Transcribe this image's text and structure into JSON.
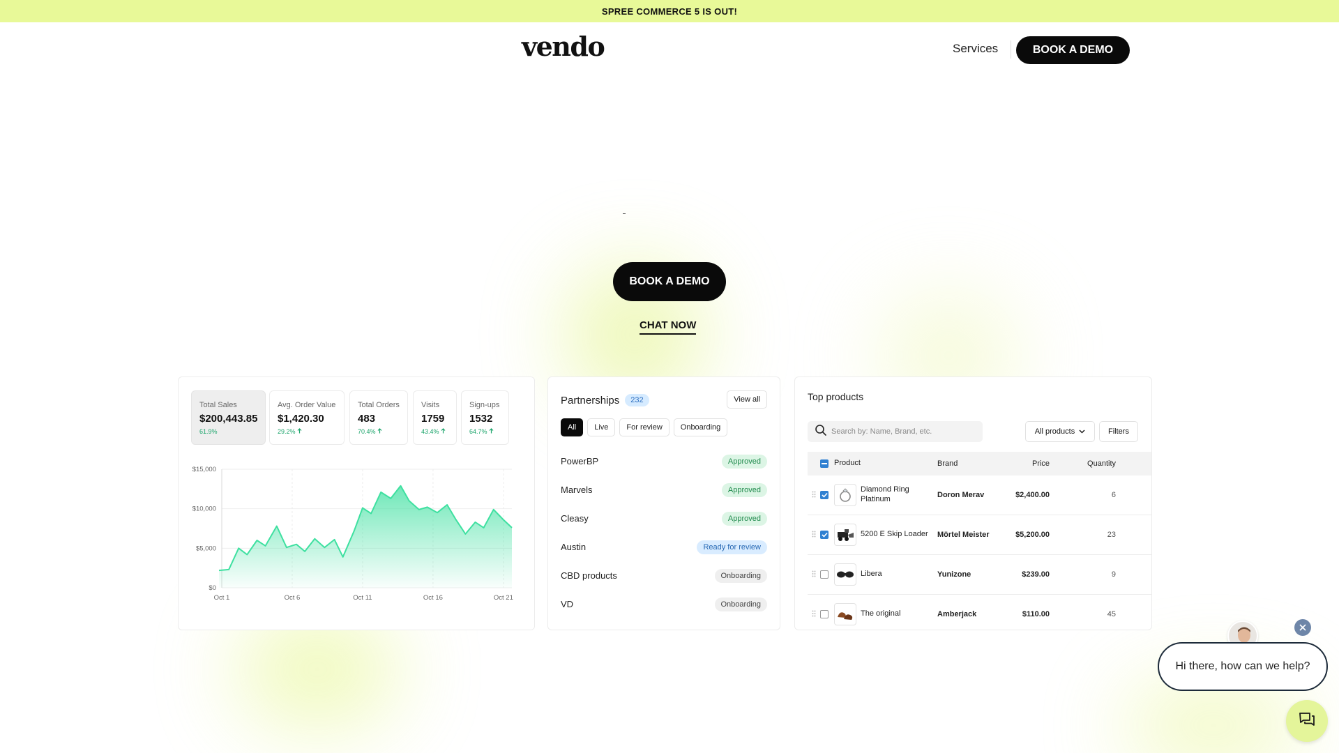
{
  "announcement": {
    "text": "SPREE COMMERCE 5 IS OUT!"
  },
  "header": {
    "logo": "vendo",
    "nav": {
      "services": "Services",
      "book_demo": "BOOK A DEMO"
    }
  },
  "hero": {
    "dash": "-",
    "book_demo": "BOOK A DEMO",
    "chat_now": "CHAT NOW"
  },
  "stats": {
    "metrics": [
      {
        "label": "Total Sales",
        "value": "$200,443.85",
        "delta": "61.9%",
        "active": true,
        "arrow": false
      },
      {
        "label": "Avg. Order Value",
        "value": "$1,420.30",
        "delta": "29.2%",
        "active": false,
        "arrow": true
      },
      {
        "label": "Total Orders",
        "value": "483",
        "delta": "70.4%",
        "active": false,
        "arrow": true
      },
      {
        "label": "Visits",
        "value": "1759",
        "delta": "43.4%",
        "active": false,
        "arrow": true
      },
      {
        "label": "Sign-ups",
        "value": "1532",
        "delta": "64.7%",
        "active": false,
        "arrow": true
      }
    ],
    "accent": "#3ee0a0"
  },
  "chart_data": {
    "type": "area",
    "title": "",
    "xlabel": "",
    "ylabel": "",
    "ylim": [
      0,
      15000
    ],
    "yticks": [
      "$0",
      "$5,000",
      "$10,000",
      "$15,000"
    ],
    "ytick_values": [
      0,
      5000,
      10000,
      15000
    ],
    "xticks": [
      "Oct 1",
      "Oct 6",
      "Oct 11",
      "Oct 16",
      "Oct 21"
    ],
    "xtick_positions": [
      1,
      6,
      11,
      16,
      21
    ],
    "xlim": [
      1,
      21.6
    ],
    "grid": true,
    "series": [
      {
        "x": [
          0.8,
          1.5,
          2.2,
          2.8,
          3.5,
          4.1,
          4.9,
          5.6,
          6.3,
          6.9,
          7.6,
          8.3,
          9.0,
          9.6,
          10.4,
          11.0,
          11.6,
          12.3,
          13.0,
          13.7,
          14.3,
          15.0,
          15.6,
          16.3,
          17.0,
          17.6,
          18.3,
          19.0,
          19.6,
          20.3,
          21.0,
          21.6
        ],
        "y": [
          2200,
          2300,
          5000,
          4200,
          6000,
          5300,
          7800,
          5100,
          5500,
          4600,
          6200,
          5100,
          6100,
          3900,
          7200,
          10100,
          9400,
          12100,
          11300,
          12900,
          11000,
          9900,
          10200,
          9500,
          10500,
          8700,
          6800,
          8300,
          7600,
          9900,
          8600,
          7600
        ]
      }
    ]
  },
  "partnerships": {
    "title": "Partnerships",
    "count": "232",
    "view_all": "View all",
    "tabs": [
      "All",
      "Live",
      "For review",
      "Onboarding"
    ],
    "rows": [
      {
        "name": "PowerBP",
        "status": "Approved",
        "kind": "approved"
      },
      {
        "name": "Marvels",
        "status": "Approved",
        "kind": "approved"
      },
      {
        "name": "Cleasy",
        "status": "Approved",
        "kind": "approved"
      },
      {
        "name": "Austin",
        "status": "Ready for review",
        "kind": "review"
      },
      {
        "name": "CBD products",
        "status": "Onboarding",
        "kind": "onboarding"
      },
      {
        "name": "VD",
        "status": "Onboarding",
        "kind": "onboarding"
      }
    ]
  },
  "products": {
    "title": "Top products",
    "search_placeholder": "Search by: Name, Brand, etc.",
    "all_products": "All products",
    "filters": "Filters",
    "columns": {
      "product": "Product",
      "brand": "Brand",
      "price": "Price",
      "quantity": "Quantity"
    },
    "rows": [
      {
        "product": "Diamond Ring Platinum",
        "brand": "Doron Merav",
        "price": "$2,400.00",
        "quantity": "6",
        "checked": true,
        "icon": "ring-icon"
      },
      {
        "product": "5200 E Skip Loader",
        "brand": "Mörtel Meister",
        "price": "$5,200.00",
        "quantity": "23",
        "checked": true,
        "icon": "loader-icon"
      },
      {
        "product": "Libera",
        "brand": "Yunizone",
        "price": "$239.00",
        "quantity": "9",
        "checked": false,
        "icon": "sunglasses-icon"
      },
      {
        "product": "The original",
        "brand": "Amberjack",
        "price": "$110.00",
        "quantity": "45",
        "checked": false,
        "icon": "shoes-icon"
      }
    ]
  },
  "chat_widget": {
    "message": "Hi there, how can we help?"
  }
}
